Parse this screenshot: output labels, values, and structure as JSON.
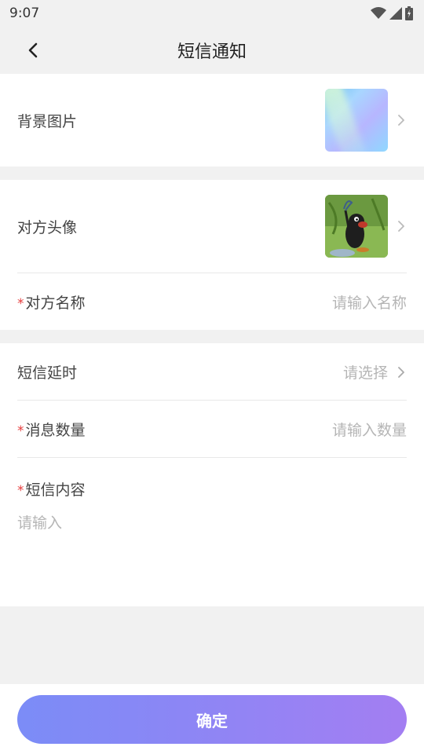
{
  "status_bar": {
    "time": "9:07"
  },
  "nav": {
    "title": "短信通知"
  },
  "background_section": {
    "label": "背景图片"
  },
  "contact_section": {
    "avatar_label": "对方头像",
    "name_label": "对方名称",
    "name_placeholder": "请输入名称"
  },
  "message_section": {
    "delay_label": "短信延时",
    "delay_value": "请选择",
    "count_label": "消息数量",
    "count_placeholder": "请输入数量",
    "content_label": "短信内容",
    "content_placeholder": "请输入"
  },
  "required_mark": "*",
  "footer": {
    "confirm_label": "确定"
  },
  "colors": {
    "required": "#e63c3c",
    "button_gradient_start": "#7b8cf7",
    "button_gradient_end": "#a37ef2",
    "placeholder": "#b5b5b5"
  }
}
